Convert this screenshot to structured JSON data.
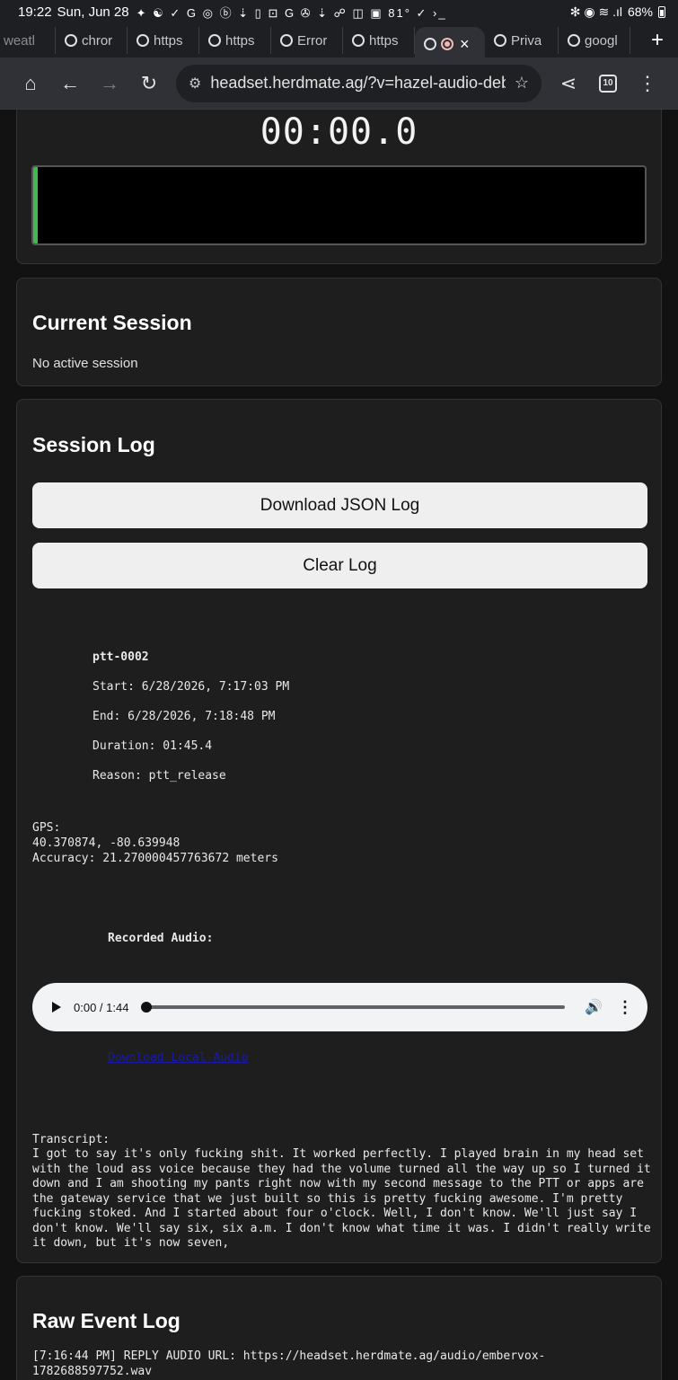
{
  "status_bar": {
    "time": "19:22",
    "date": "Sun, Jun 28",
    "notification_icons": "✦ ☯ ✓ G ◎ ⓑ ⇣ ▯ ⊡ G ✇ ⇣ ☍ ◫ ▣ 81° ✓ ›_",
    "right_icons": "✻ ◉ ≋ .ıl",
    "battery": "68%"
  },
  "tabs": [
    {
      "label": "weatl"
    },
    {
      "label": "chror"
    },
    {
      "label": "https"
    },
    {
      "label": "https"
    },
    {
      "label": "Error"
    },
    {
      "label": "https"
    },
    {
      "label": "",
      "active": true
    },
    {
      "label": "Priva"
    },
    {
      "label": "googl"
    }
  ],
  "toolbar": {
    "url": "headset.herdmate.ag/?v=hazel-audio-deb",
    "tab_count": "10"
  },
  "recorder": {
    "timer": "00:00.0",
    "level": 0.0,
    "level_color": "#3fb950"
  },
  "current_session": {
    "title": "Current Session",
    "status": "No active session"
  },
  "session_log": {
    "title": "Session Log",
    "download_button": "Download JSON Log",
    "clear_button": "Clear Log",
    "entry": {
      "id": "ptt-0002",
      "start": "Start: 6/28/2026, 7:17:03 PM",
      "end": "End: 6/28/2026, 7:18:48 PM",
      "duration": "Duration: 01:45.4",
      "reason": "Reason: ptt_release",
      "gps_label": "GPS:",
      "gps_coords": "40.370874, -80.639948",
      "gps_accuracy": "Accuracy: 21.270000457763672 meters",
      "recorded_audio_label": "Recorded Audio:",
      "audio_time": "0:00 / 1:44",
      "audio_progress": 0.0,
      "download_audio_link": "Download Local Audio",
      "transcript_label": "Transcript:",
      "transcript": "I got to say it's only fucking shit. It worked perfectly. I played brain in my head set with the loud ass voice because they had the volume turned all the way up so I turned it down and I am shooting my pants right now with my second message to the PTT or apps are the gateway service that we just built so this is pretty fucking awesome. I'm pretty fucking stoked. And I started about four o'clock. Well, I don't know. We'll just say I don't know. We'll say six, six a.m. I don't know what time it was. I didn't really write it down, but it's now seven,"
    }
  },
  "raw_event_log": {
    "title": "Raw Event Log",
    "line1": "[7:16:44 PM] REPLY AUDIO URL: https://headset.herdmate.ag/audio/embervox-1782688597752.wav"
  }
}
